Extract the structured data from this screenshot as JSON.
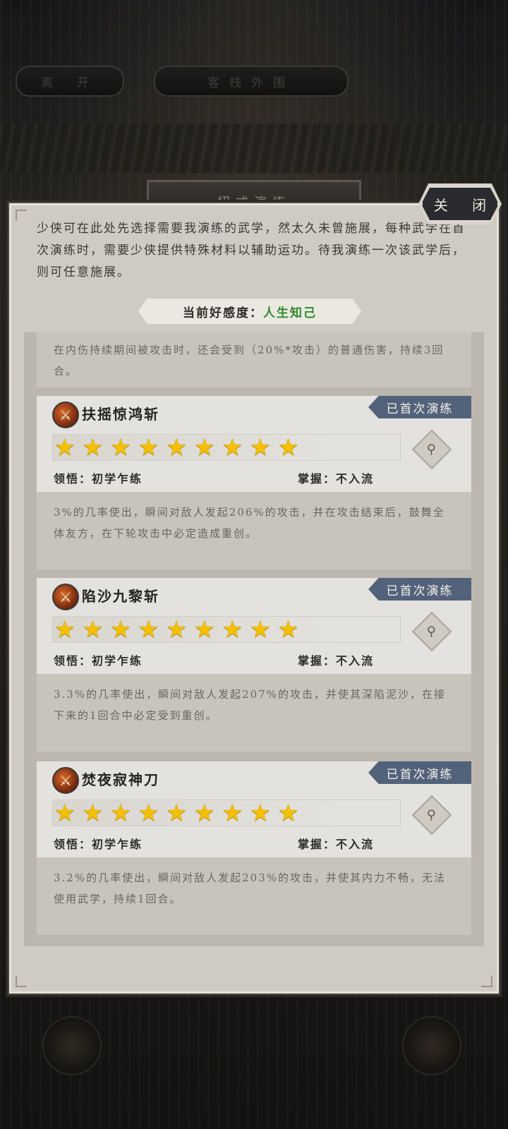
{
  "background": {
    "left_button": "离 开",
    "center_button": "客栈外围",
    "tab_behind": "招式演练"
  },
  "dialog": {
    "close_label": "关 闭",
    "intro": "少侠可在此处先选择需要我演练的武学，然太久未曾施展，每种武学在首次演练时，需要少侠提供特殊材料以辅助运功。待我演练一次该武学后，则可任意施展。",
    "favor_label": "当前好感度：",
    "favor_value": "人生知己"
  },
  "list": {
    "partial_desc": "在内伤持续期间被攻击时，还会受到（20%*攻击）的普通伤害，持续3回合。",
    "skills": [
      {
        "name": "扶摇惊鸿斩",
        "badge": "已首次演练",
        "stars": 9,
        "comprehension_label": "领悟：",
        "comprehension_value": "初学乍练",
        "mastery_label": "掌握：",
        "mastery_value": "不入流",
        "desc": "3%的几率使出，瞬间对敌人发起206%的攻击，并在攻击结束后，鼓舞全体友方，在下轮攻击中必定造成重创。"
      },
      {
        "name": "陷沙九黎斩",
        "badge": "已首次演练",
        "stars": 9,
        "comprehension_label": "领悟：",
        "comprehension_value": "初学乍练",
        "mastery_label": "掌握：",
        "mastery_value": "不入流",
        "desc": "3.3%的几率使出，瞬间对敌人发起207%的攻击，并使其深陷泥沙，在接下来的1回合中必定受到重创。"
      },
      {
        "name": "焚夜寂神刀",
        "badge": "已首次演练",
        "stars": 9,
        "comprehension_label": "领悟：",
        "comprehension_value": "初学乍练",
        "mastery_label": "掌握：",
        "mastery_value": "不入流",
        "desc": "3.2%的几率使出，瞬间对敌人发起203%的攻击，并使其内力不畅，无法使用武学，持续1回合。"
      }
    ]
  },
  "icons": {
    "skill": "sword-skill-icon",
    "star": "star-icon",
    "zoom": "magnifier-icon"
  },
  "colors": {
    "badge_bg": "#52627a",
    "favor_value": "#2e8a2b",
    "star": "#f5c000"
  }
}
